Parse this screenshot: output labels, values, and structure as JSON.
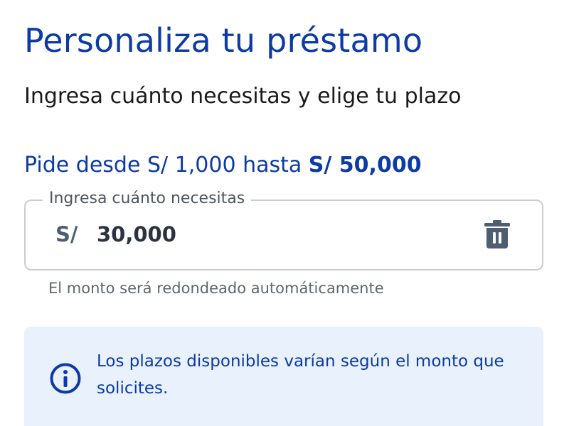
{
  "header": {
    "title": "Personaliza tu préstamo",
    "subtitle": "Ingresa cuánto necesitas y elige tu plazo"
  },
  "range": {
    "prefix": "Pide desde S/ 1,000 hasta ",
    "max": "S/ 50,000"
  },
  "amount_field": {
    "legend": "Ingresa cuánto necesitas",
    "currency": "S/",
    "value": "30,000",
    "clear_icon": "trash-icon"
  },
  "helper_text": "El monto será redondeado automáticamente",
  "info": {
    "icon": "info-icon",
    "text": "Los plazos disponibles varían según el monto que solicites."
  },
  "colors": {
    "brand_blue": "#0c3aa6",
    "info_background": "#e8f1fc",
    "field_border": "#c9cdd3",
    "icon_gray": "#4f5d72"
  }
}
